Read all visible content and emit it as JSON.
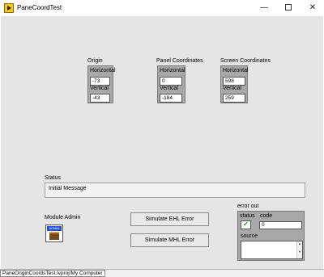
{
  "window": {
    "title": "PaneCoordTest",
    "minimize_icon": "minimize-icon",
    "maximize_icon": "maximize-icon",
    "close_icon": "close-icon"
  },
  "origin": {
    "label": "Origin",
    "horizontal_label": "Horizontal",
    "horizontal": "-73",
    "vertical_label": "Vertical",
    "vertical": "-43"
  },
  "panel_coords": {
    "label": "Panel Coordinates",
    "horizontal_label": "Horizontal",
    "horizontal": "0",
    "vertical_label": "Vertical",
    "vertical": "-184"
  },
  "screen_coords": {
    "label": "Screen Coordinates",
    "horizontal_label": "Horizontal",
    "horizontal": "598",
    "vertical_label": "Vertical",
    "vertical": "259"
  },
  "status": {
    "label": "Status",
    "value": "Initial Message"
  },
  "module_admin": {
    "label": "Module Admin",
    "icon_text": "ADMIN"
  },
  "buttons": {
    "ehl": "Simulate EHL Error",
    "mhl": "Simulate MHL Error"
  },
  "error_out": {
    "label": "error out",
    "status_label": "status",
    "code_label": "code",
    "code_value": "0",
    "source_label": "source",
    "status_value": "ok"
  },
  "statusbar": {
    "project_path": "PaneOriginCoordsTest.lvproj/My Computer"
  }
}
